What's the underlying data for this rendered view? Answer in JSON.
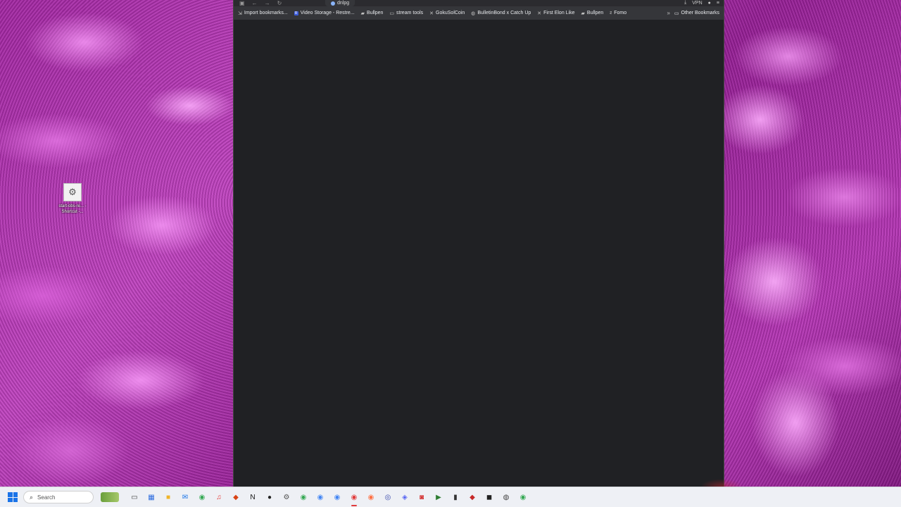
{
  "desktop": {
    "icons": [
      {
        "label": "start-obs-re... - Shortcut -..."
      }
    ]
  },
  "browser": {
    "tab_title": "dnlpg",
    "nav_icons": [
      "sidebar-icon",
      "back-icon",
      "forward-icon",
      "reload-icon"
    ],
    "toolbar_right": {
      "vpn_label": "VPN"
    },
    "bookmarks": [
      {
        "label": "Import bookmarks...",
        "icon": "import-icon"
      },
      {
        "label": "Video Storage - Restre...",
        "icon": "restream-icon"
      },
      {
        "label": "Bullpen",
        "icon": "bullpen-icon"
      },
      {
        "label": "stream tools",
        "icon": "folder-icon"
      },
      {
        "label": "GokuSolCoin",
        "icon": "x-icon"
      },
      {
        "label": "BulletinBond x Catch Up",
        "icon": "globe-icon"
      },
      {
        "label": "First Elon Like",
        "icon": "x-icon"
      },
      {
        "label": "Bullpen",
        "icon": "bullpen-icon"
      },
      {
        "label": "Fomo",
        "icon": "fomo-icon"
      }
    ],
    "other_bookmarks_label": "Other Bookmarks"
  },
  "taskbar": {
    "search_placeholder": "Search",
    "apps": [
      {
        "name": "file-explorer-icon",
        "glyph": "▭",
        "color": "#444"
      },
      {
        "name": "calendar-icon",
        "glyph": "▦",
        "color": "#2d6cdf"
      },
      {
        "name": "folder-icon",
        "glyph": "■",
        "color": "#f0b429"
      },
      {
        "name": "mail-icon",
        "glyph": "✉",
        "color": "#1a73e8"
      },
      {
        "name": "chrome-icon",
        "glyph": "◉",
        "color": "#34a853"
      },
      {
        "name": "music-icon",
        "glyph": "♫",
        "color": "#e53935"
      },
      {
        "name": "app-icon",
        "glyph": "◆",
        "color": "#d84315"
      },
      {
        "name": "notion-icon",
        "glyph": "N",
        "color": "#111"
      },
      {
        "name": "obs-icon",
        "glyph": "●",
        "color": "#222"
      },
      {
        "name": "settings-icon",
        "glyph": "⚙",
        "color": "#555"
      },
      {
        "name": "chrome-icon",
        "glyph": "◉",
        "color": "#34a853"
      },
      {
        "name": "chrome-icon",
        "glyph": "◉",
        "color": "#4285f4"
      },
      {
        "name": "chrome-icon",
        "glyph": "◉",
        "color": "#4285f4"
      },
      {
        "name": "chrome-icon",
        "glyph": "◉",
        "color": "#e03a3a",
        "active": true
      },
      {
        "name": "firefox-icon",
        "glyph": "◉",
        "color": "#ff7043"
      },
      {
        "name": "app-icon",
        "glyph": "◎",
        "color": "#3949ab"
      },
      {
        "name": "discord-icon",
        "glyph": "◈",
        "color": "#5865f2"
      },
      {
        "name": "app-icon",
        "glyph": "◙",
        "color": "#d32f2f"
      },
      {
        "name": "app-icon",
        "glyph": "▶",
        "color": "#2e7d32"
      },
      {
        "name": "terminal-icon",
        "glyph": "▮",
        "color": "#333"
      },
      {
        "name": "app-icon",
        "glyph": "◆",
        "color": "#c62828"
      },
      {
        "name": "app-icon",
        "glyph": "◼",
        "color": "#212121"
      },
      {
        "name": "app-icon",
        "glyph": "◍",
        "color": "#424242"
      },
      {
        "name": "chrome-icon",
        "glyph": "◉",
        "color": "#34a853"
      }
    ]
  }
}
